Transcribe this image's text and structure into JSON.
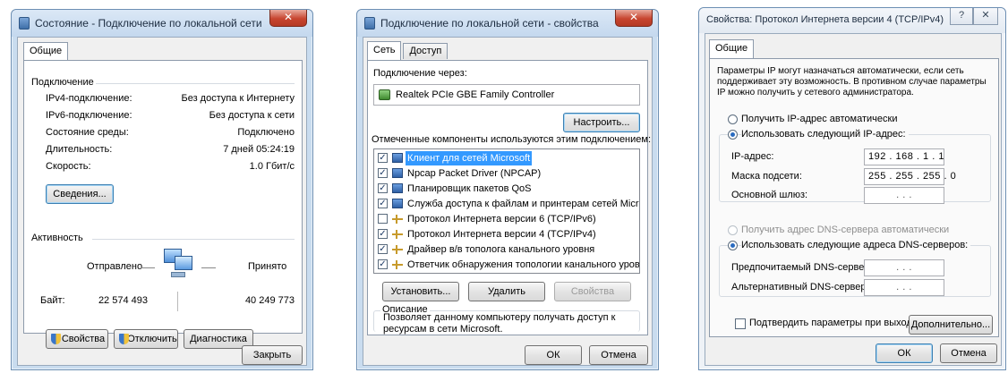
{
  "win1": {
    "title": "Состояние - Подключение по локальной сети",
    "close": "✕",
    "tabs": [
      "Общие"
    ],
    "connection": {
      "header": "Подключение",
      "rows": [
        {
          "label": "IPv4-подключение:",
          "value": "Без доступа к Интернету"
        },
        {
          "label": "IPv6-подключение:",
          "value": "Без доступа к сети"
        },
        {
          "label": "Состояние среды:",
          "value": "Подключено"
        },
        {
          "label": "Длительность:",
          "value": "7 дней 05:24:19"
        },
        {
          "label": "Скорость:",
          "value": "1.0 Гбит/с"
        }
      ],
      "details_button": "Сведения..."
    },
    "activity": {
      "header": "Активность",
      "sent_label": "Отправлено",
      "received_label": "Принято",
      "bytes_label": "Байт:",
      "bytes_sent": "22 574 493",
      "bytes_received": "40 249 773"
    },
    "buttons": {
      "properties": "Свойства",
      "disable": "Отключить",
      "diagnostics": "Диагностика",
      "close": "Закрыть"
    }
  },
  "win2": {
    "title": "Подключение по локальной сети - свойства",
    "close": "✕",
    "tabs": [
      "Сеть",
      "Доступ"
    ],
    "connect_using_label": "Подключение через:",
    "adapter": "Realtek PCIe GBE Family Controller",
    "configure_button": "Настроить...",
    "components_label": "Отмеченные компоненты используются этим подключением:",
    "components": [
      {
        "label": "Клиент для сетей Microsoft",
        "checked": true,
        "icon": "network-client-icon",
        "selected": true
      },
      {
        "label": "Npcap Packet Driver (NPCAP)",
        "checked": true,
        "icon": "network-driver-icon",
        "selected": false
      },
      {
        "label": "Планировщик пакетов QoS",
        "checked": true,
        "icon": "network-driver-icon",
        "selected": false
      },
      {
        "label": "Служба доступа к файлам и принтерам сетей Micro...",
        "checked": true,
        "icon": "network-service-icon",
        "selected": false
      },
      {
        "label": "Протокол Интернета версии 6 (TCP/IPv6)",
        "checked": false,
        "icon": "protocol-icon",
        "selected": false
      },
      {
        "label": "Протокол Интернета версии 4 (TCP/IPv4)",
        "checked": true,
        "icon": "protocol-icon",
        "selected": false
      },
      {
        "label": "Драйвер в/в тополога канального уровня",
        "checked": true,
        "icon": "protocol-icon",
        "selected": false
      },
      {
        "label": "Ответчик обнаружения топологии канального уровня",
        "checked": true,
        "icon": "protocol-icon",
        "selected": false
      }
    ],
    "install_button": "Установить...",
    "remove_button": "Удалить",
    "properties_button": "Свойства",
    "description_header": "Описание",
    "description": [
      "Позволяет данному компьютеру получать доступ к",
      "ресурсам в сети Microsoft."
    ],
    "ok_button": "ОК",
    "cancel_button": "Отмена"
  },
  "win3": {
    "title": "Свойства: Протокол Интернета версии 4 (TCP/IPv4)",
    "help": "?",
    "close": "✕",
    "tabs": [
      "Общие"
    ],
    "intro": [
      "Параметры IP могут назначаться автоматически, если сеть",
      "поддерживает эту возможность. В противном случае параметры",
      "IP можно получить у сетевого администратора."
    ],
    "ip_auto": "Получить IP-адрес автоматически",
    "ip_manual": "Использовать следующий IP-адрес:",
    "ip_label": "IP-адрес:",
    "ip_value": "192 . 168 . 1 . 1",
    "mask_label": "Маска подсети:",
    "mask_value": "255 . 255 . 255 . 0",
    "gateway_label": "Основной шлюз:",
    "gateway_value": ". . .",
    "dns_auto": "Получить адрес DNS-сервера автоматически",
    "dns_manual": "Использовать следующие адреса DNS-серверов:",
    "dns_pref_label": "Предпочитаемый DNS-сервер:",
    "dns_pref_value": ". . .",
    "dns_alt_label": "Альтернативный DNS-сервер:",
    "dns_alt_value": ". . .",
    "validate_label": "Подтвердить параметры при выходе",
    "advanced_button": "Дополнительно...",
    "ok_button": "ОК",
    "cancel_button": "Отмена"
  }
}
